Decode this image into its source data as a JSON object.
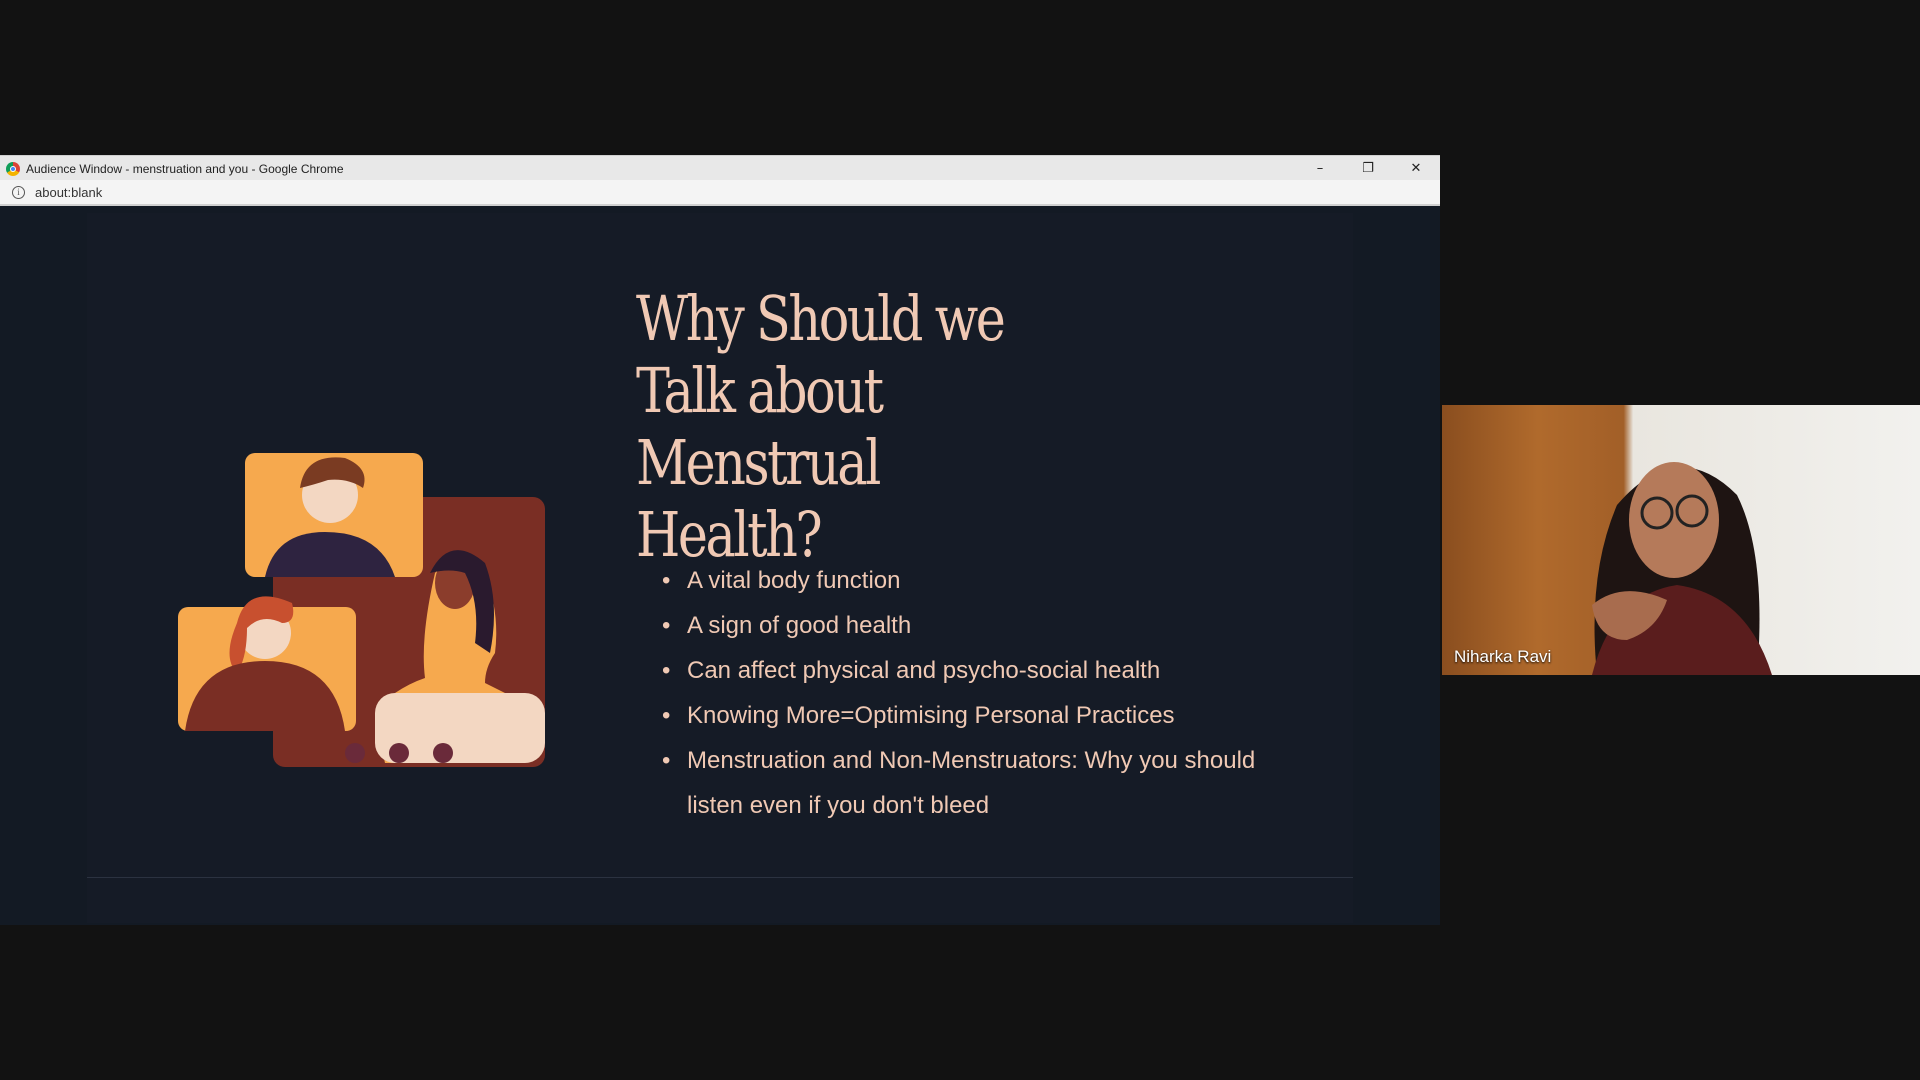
{
  "window": {
    "title": "Audience Window - menstruation and you - Google Chrome",
    "url": "about:blank",
    "controls": {
      "minimize": "–",
      "restore": "❐",
      "close": "✕"
    }
  },
  "slide": {
    "title": "Why Should we Talk about Menstrual Health?",
    "bullets": [
      "A vital body function",
      "A sign of good health",
      "Can affect physical and psycho-social health",
      "Knowing More=Optimising Personal Practices",
      "Menstruation and Non-Menstruators: Why you should listen even if you don't bleed"
    ]
  },
  "video": {
    "participant_name": "Niharka Ravi"
  },
  "colors": {
    "slide_bg": "#151b26",
    "text_accent": "#f0c9b4",
    "illustration_orange": "#f6a94e",
    "illustration_maroon": "#7a2e24"
  }
}
